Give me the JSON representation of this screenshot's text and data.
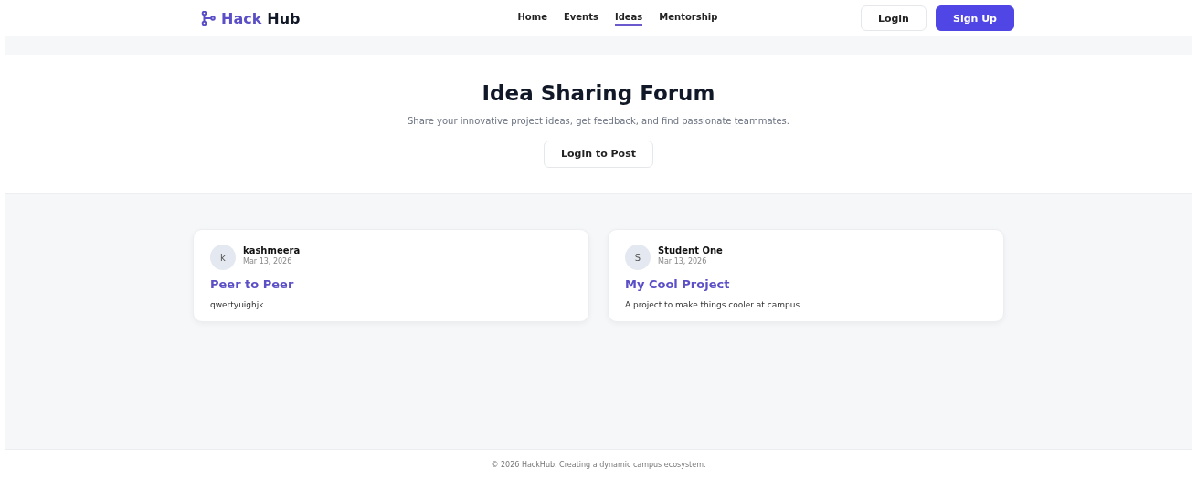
{
  "brand": {
    "first": "Hack",
    "second": "Hub"
  },
  "nav": [
    {
      "label": "Home",
      "selected": false
    },
    {
      "label": "Events",
      "selected": false
    },
    {
      "label": "Ideas",
      "selected": true
    },
    {
      "label": "Mentorship",
      "selected": false
    }
  ],
  "auth": {
    "login": "Login",
    "signup": "Sign Up"
  },
  "hero": {
    "title": "Idea Sharing Forum",
    "subtitle": "Share your innovative project ideas, get feedback, and find passionate teammates.",
    "button": "Login to Post"
  },
  "ideas": [
    {
      "initial": "k",
      "author": "kashmeera",
      "date": "Mar 13, 2026",
      "title": "Peer to Peer",
      "body": "qwertyuighjk"
    },
    {
      "initial": "S",
      "author": "Student One",
      "date": "Mar 13, 2026",
      "title": "My Cool Project",
      "body": "A project to make things cooler at campus."
    }
  ],
  "footer": "© 2026 HackHub. Creating a dynamic campus ecosystem."
}
